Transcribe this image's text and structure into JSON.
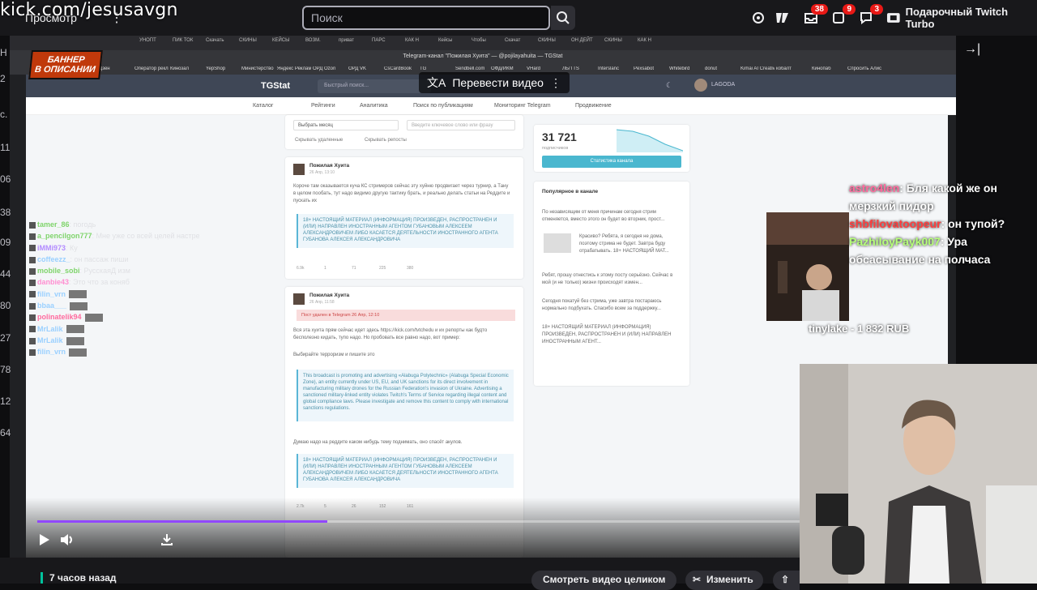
{
  "watermark": "kick.com/jesusavgn",
  "topnav": {
    "browse_label": "Просмотр",
    "more_label": "⋮",
    "search_placeholder": "Поиск",
    "turbo_label": "Подарочный Twitch Turbo"
  },
  "badges": {
    "inbox": "38",
    "activity": "9",
    "whispers": "3"
  },
  "left_rail": [
    "H",
    "2",
    "с.",
    "11",
    "06",
    "38",
    "09",
    "44",
    "80",
    "27",
    "78",
    "12",
    "64"
  ],
  "browser": {
    "tabs": [
      "УНОПТ",
      "ПИК ТОК",
      "Скачать",
      "СКИНЫ",
      "КЕЙСЫ",
      "ВОЗМ.",
      "приват",
      "ПАРС",
      "КАК Н",
      "Кейсы",
      "Чтобы",
      "Скачат",
      "СКИНЫ",
      "ОН ДЕЙТ",
      "СКИНЫ",
      "КАК Н"
    ],
    "window_title": "Telegram-канал \"Пожилая Хуита\" — @pojilayahuita — TGStat",
    "bookmarks": [
      "Дзен",
      "Оператор реклам",
      "Кинозал",
      "YepShop",
      "Министерство",
      "Яндекс Реклама",
      "ОРД Ozon",
      "ОРД VK",
      "CsCardBook",
      "TG",
      "Sendbell.com",
      "ОФД/ИКМ",
      "VHard",
      "ЛБ/TTS",
      "Interslanc",
      "Pexsabot",
      "Whitebird",
      "donut",
      "Kimai AI Creative",
      "кобалт",
      "Кинопаб",
      "Спросить Алису AI"
    ]
  },
  "banner": {
    "line1": "БАННЕР",
    "line2": "В ОПИСАНИИ"
  },
  "translate_label": "Перевести видео",
  "tgstat": {
    "logo": "TGStat",
    "search_placeholder": "Быстрый поиск...",
    "user": "LAGODA",
    "nav": [
      "Каталог",
      "Рейтинги",
      "Аналитика",
      "Поиск по публикациям",
      "Мониторинг Telegram",
      "Продвижение"
    ],
    "month_select": "Выбрать месяц",
    "keyword_placeholder": "Введите ключевое слово или фразу",
    "filter_deleted": "Скрывать удаленные",
    "filter_reposts": "Скрывать репосты",
    "post1": {
      "author": "Пожилая Хуита",
      "date": "26 Апр, 13:10",
      "text": "Короче там оказывается куча КС стримеров сейчас эту хуйню продвигает через турнир, а Тану в целом пообать, тут надо видимо другую тактику брать, и реально делать статьи на Реддите и пускать их",
      "warning": "18+ НАСТОЯЩИЙ МАТЕРИАЛ (ИНФОРМАЦИЯ) ПРОИЗВЕДЕН, РАСПРОСТРАНЕН И (ИЛИ) НАПРАВЛЕН ИНОСТРАННЫМ АГЕНТОМ ГУБАНОВЫМ АЛЕКСЕЕМ АЛЕКСАНДРОВИЧЕМ ЛИБО КАСАЕТСЯ ДЕЯТЕЛЬНОСТИ ИНОСТРАННОГО АГЕНТА ГУБАНОВА АЛЕКСЕЯ АЛЕКСАНДРОВИЧА",
      "stats": [
        "6.9k",
        "1",
        "71",
        "225",
        "380"
      ]
    },
    "post2": {
      "author": "Пожилая Хуита",
      "date": "26 Апр, 11:58",
      "deleted_notice": "Пост удален в Telegram 26 Апр, 12:10",
      "text": "Вся эта хуита прям сейчас идет здесь https://kick.com/tvtchedu и их репорты как будто бесполезно кидать, тупо надо. Но пробовать все равно надо, вот пример:",
      "subtext": "Выбирайте терроризм и пишите это",
      "english": "This broadcast is promoting and advertising «Alabuga Polytechnic» (Alabuga Special Economic Zone), an entity currently under US, EU, and UK sanctions for its direct involvement in manufacturing military drones for the Russian Federation's invasion of Ukraine. Advertising a sanctioned military-linked entity violates Twitch's Terms of Service regarding illegal content and global compliance laws. Please investigate and remove this content to comply with international sanctions regulations.",
      "outro": "Думаю надо на реддите каком нибудь тему поднимать, оно спасёт акулов.",
      "warning": "18+ НАСТОЯЩИЙ МАТЕРИАЛ (ИНФОРМАЦИЯ) ПРОИЗВЕДЕН, РАСПРОСТРАНЕН И (ИЛИ) НАПРАВЛЕН ИНОСТРАННЫМ АГЕНТОМ ГУБАНОВЫМ АЛЕКСЕЕМ АЛЕКСАНДРОВИЧЕМ ЛИБО КАСАЕТСЯ ДЕЯТЕЛЬНОСТИ ИНОСТРАННОГО АГЕНТА ГУБАНОВА АЛЕКСЕЯ АЛЕКСАНДРОВИЧА",
      "stats": [
        "2.7k",
        "5",
        "26",
        "152",
        "161"
      ]
    },
    "post3_author": "Пожилая Хуита",
    "stats_widget": {
      "subscribers": "31 721",
      "subscribers_label": "подписчиков",
      "button": "Статистика канала"
    },
    "popular": {
      "title": "Популярное в канале",
      "items": [
        "По независящим от меня причинам сегодня стрим отменяется, вместо этого он будет во вторник, прост...",
        "Красиво? Ребята, я сегодня не дома, поэтому стрима не будет. Завтра буду отрабатывать. 18+ НАСТОЯЩИЙ МАТ...",
        "Ребят, прошу отнестись к этому посту серьёзно. Сейчас в мой (и не только) жизни происходят измен...",
        "Сегодня покатуй без стрима, уже завтра постараюсь нормально подбухать. Спасибо всем за поддержку...",
        "18+ НАСТОЯЩИЙ МАТЕРИАЛ (ИНФОРМАЦИЯ) ПРОИЗВЕДЕН, РАСПРОСТРАНЕН И (ИЛИ) НАПРАВЛЕН ИНОСТРАННЫМ АГЕНТ..."
      ]
    }
  },
  "chat": [
    {
      "user": "tamer_86",
      "msg": "погодь",
      "color": "#7fd46b"
    },
    {
      "user": "a_pencilgon777",
      "msg": "Мне уже со всей целей настрекламе albabуги собрано уронов даже на сайтах аниме",
      "color": "#7fd46b"
    },
    {
      "user": "iMMi973",
      "msg": "Ку",
      "color": "#b38cff"
    },
    {
      "user": "coffeezz_",
      "msg": "он пассаж пиши",
      "color": "#9ad0ff"
    },
    {
      "user": "mobile_sobi",
      "msg": "РусскаяД изм",
      "color": "#7fd46b"
    },
    {
      "user": "danbie43",
      "msg": "Это что за коняб",
      "color": "#ff8fd1"
    },
    {
      "user": "filin_vrn",
      "msg": "",
      "color": "#9ad0ff"
    },
    {
      "user": "bbaa___",
      "msg": "",
      "color": "#9ad0ff"
    },
    {
      "user": "polinatelik94",
      "msg": "",
      "color": "#ff6b9e"
    },
    {
      "user": "MrLalik",
      "msg": "",
      "color": "#9ad0ff"
    },
    {
      "user": "MrLalik",
      "msg": "",
      "color": "#9ad0ff"
    },
    {
      "user": "filin_vrn",
      "msg": "",
      "color": "#9ad0ff"
    }
  ],
  "overlay_chat": [
    {
      "user": "astro4len",
      "msg": ": Бля какой же он мерзкий пидор",
      "color": "#ff6b9e"
    },
    {
      "user": "shbfilovatoopeur",
      "msg": ": он тупой?",
      "color": "#ff3d3d"
    },
    {
      "user": "PazhiloyPayk007",
      "msg": ": Ура обсасывание на полчаса",
      "color": "#b6ff7a"
    }
  ],
  "donation": "tinylake - 1 832 RUB",
  "bottom": {
    "ago": "7 часов назад",
    "watch_full": "Смотреть видео целиком",
    "edit": "Изменить",
    "share": "Поделиться"
  },
  "progress": 0.38,
  "colors": {
    "accent": "#9147ff",
    "badge": "#e91916",
    "tg_accent": "#4ab7cf"
  }
}
